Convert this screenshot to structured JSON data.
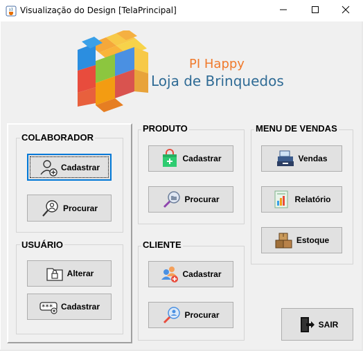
{
  "window": {
    "title": "Visualização do Design [TelaPrincipal]"
  },
  "logo": {
    "line1": "PI Happy",
    "line2": "Loja de Brinquedos"
  },
  "colaborador": {
    "title": "COLABORADOR",
    "cadastrar_label": "Cadastrar",
    "procurar_label": "Procurar"
  },
  "usuario": {
    "title": "USUÁRIO",
    "alterar_label": "Alterar",
    "cadastrar_label": "Cadastrar"
  },
  "produto": {
    "title": "PRODUTO",
    "cadastrar_label": "Cadastrar",
    "procurar_label": "Procurar"
  },
  "cliente": {
    "title": "CLIENTE",
    "cadastrar_label": "Cadastrar",
    "procurar_label": "Procurar"
  },
  "vendas_menu": {
    "title": "MENU DE VENDAS",
    "vendas_label": "Vendas",
    "relatorio_label": "Relatório",
    "estoque_label": "Estoque"
  },
  "exit": {
    "label": "SAIR"
  },
  "icons": {
    "app": "java-cup-icon",
    "minimize": "minimize-icon",
    "maximize": "maximize-icon",
    "close": "close-icon"
  },
  "colors": {
    "accent": "#0078d7",
    "logo_orange": "#f07a2c",
    "logo_blue": "#2f6b95"
  }
}
